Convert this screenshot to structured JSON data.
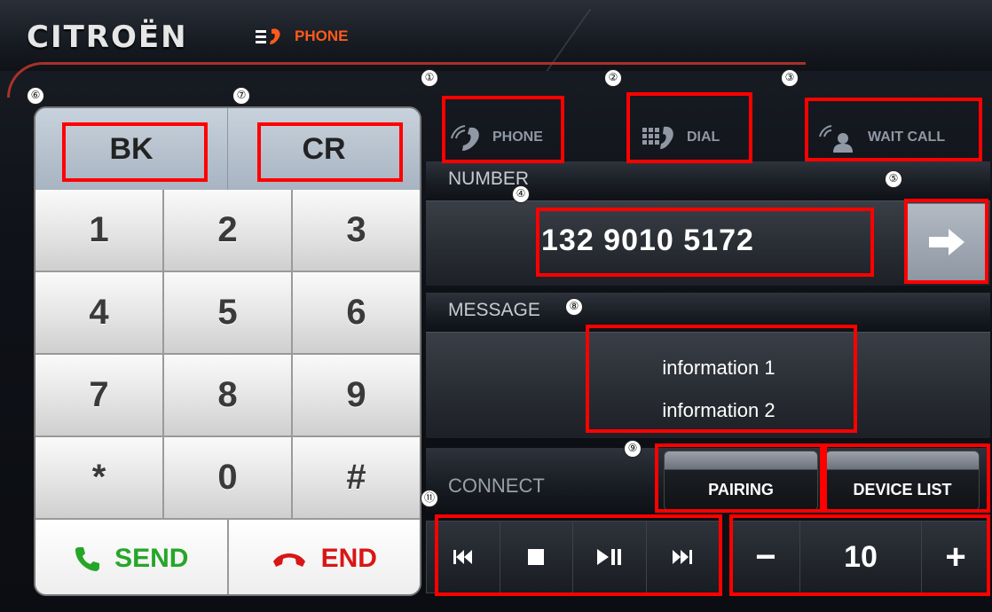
{
  "header": {
    "brand": "CITROËN",
    "app_title": "PHONE",
    "accent_color": "#ff5a1a"
  },
  "tabs": [
    {
      "label": "PHONE",
      "icon": "phone-signal-icon"
    },
    {
      "label": "DIAL",
      "icon": "dialpad-icon"
    },
    {
      "label": "WAIT CALL",
      "icon": "person-signal-icon"
    }
  ],
  "keypad": {
    "top_keys": [
      "BK",
      "CR"
    ],
    "rows": [
      [
        "1",
        "2",
        "3"
      ],
      [
        "4",
        "5",
        "6"
      ],
      [
        "7",
        "8",
        "9"
      ],
      [
        "*",
        "0",
        "#"
      ]
    ],
    "send_label": "SEND",
    "end_label": "END",
    "send_color": "#26a629",
    "end_color": "#d81616"
  },
  "number": {
    "section_label": "NUMBER",
    "value": "132  9010  5172",
    "go_icon": "arrow-right-icon"
  },
  "message": {
    "section_label": "MESSAGE",
    "lines": [
      "information 1",
      "information 2"
    ]
  },
  "connect": {
    "section_label": "CONNECT",
    "pairing_label": "PAIRING",
    "device_list_label": "DEVICE LIST"
  },
  "media": {
    "buttons": [
      "previous-track-icon",
      "stop-icon",
      "play-pause-icon",
      "next-track-icon"
    ]
  },
  "volume": {
    "minus_label": "−",
    "value": "10",
    "plus_label": "+"
  },
  "markers": [
    "①",
    "②",
    "③",
    "④",
    "⑤",
    "⑥",
    "⑦",
    "⑧",
    "⑨",
    "⑪"
  ]
}
